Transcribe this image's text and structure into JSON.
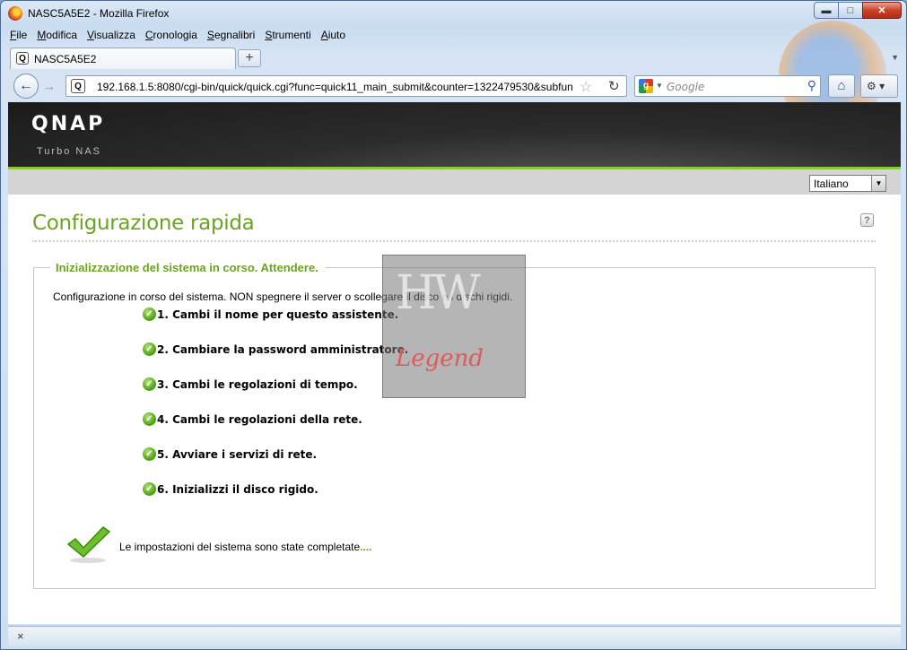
{
  "window": {
    "title": "NASC5A5E2 - Mozilla Firefox"
  },
  "menu": [
    "File",
    "Modifica",
    "Visualizza",
    "Cronologia",
    "Segnalibri",
    "Strumenti",
    "Aiuto"
  ],
  "tab": {
    "label": "NASC5A5E2",
    "icon_text": "Q"
  },
  "address": {
    "url": "192.168.1.5:8080/cgi-bin/quick/quick.cgi?func=quick11_main_submit&counter=1322479530&subfun"
  },
  "search": {
    "placeholder": "Google",
    "engine_letter": "g"
  },
  "qnap": {
    "logo": "QNAP",
    "subtitle": "Turbo NAS"
  },
  "language": {
    "selected": "Italiano"
  },
  "page": {
    "title": "Configurazione rapida",
    "help": "?",
    "legend": "Inizializzazione del sistema in corso. Attendere.",
    "description": "Configurazione in corso del sistema. NON spegnere il server o scollegare il disco o i dischi rigidi.",
    "steps": [
      "1. Cambi il nome per questo assistente.",
      "2. Cambiare la password amministratore.",
      "3. Cambi le regolazioni di tempo.",
      "4. Cambi le regolazioni della rete.",
      "5. Avviare i servizi di rete.",
      "6. Inizializzi il disco rigido."
    ],
    "completed": "Le impostazioni del sistema sono state completate",
    "completed_dots": "...."
  },
  "watermark": {
    "top": "HW",
    "bottom": "Legend"
  },
  "colors": {
    "accent_green": "#6ca31f",
    "header_dark": "#1b1b1b",
    "green_line": "#8cc63f"
  }
}
